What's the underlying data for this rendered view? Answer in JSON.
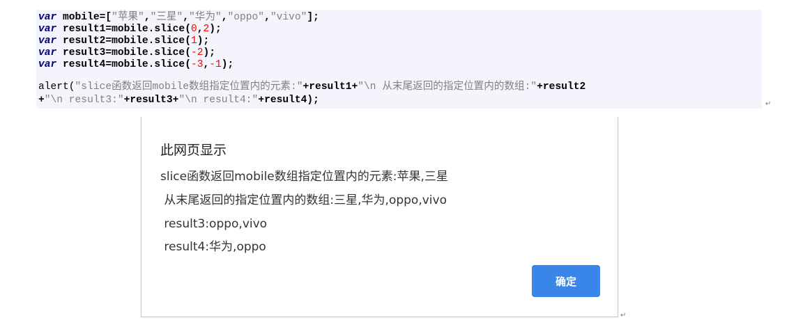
{
  "code": {
    "kw": "var",
    "line1": {
      "decl": " mobile=[",
      "items": [
        "\"苹果\"",
        "\"三星\"",
        "\"华为\"",
        "\"oppo\"",
        "\"vivo\""
      ],
      "end": "];"
    },
    "line2": {
      "decl": " result1=mobile.slice(",
      "a": "0",
      "sep": ",",
      "b": "2",
      "end": ");"
    },
    "line3": {
      "decl": " result2=mobile.slice(",
      "a": "1",
      "end": ");"
    },
    "line4": {
      "decl": " result3=mobile.slice(",
      "a": "-2",
      "end": ");"
    },
    "line5": {
      "decl": " result4=mobile.slice(",
      "a": "-3",
      "sep": ",",
      "b": "-1",
      "end": ");"
    },
    "line6": {
      "head": "alert(",
      "s1": "\"slice函数返回mobile数组指定位置内的元素:\"",
      "p1": "+result1+",
      "s2": "\"\\n 从末尾返回的指定位置内的数组:\"",
      "p2": "+result2"
    },
    "line7": {
      "p0": "+",
      "s1": "\"\\n result3:\"",
      "p1": "+result3+",
      "s2": "\"\\n result4:\"",
      "p2": "+result4);"
    }
  },
  "dialog": {
    "title": "此网页显示",
    "messages": [
      "slice函数返回mobile数组指定位置内的元素:苹果,三星",
      " 从末尾返回的指定位置内的数组:三星,华为,oppo,vivo",
      " result3:oppo,vivo",
      " result4:华为,oppo"
    ],
    "ok_label": "确定",
    "ok_color": "#3a86e8"
  },
  "para_mark": "↵"
}
